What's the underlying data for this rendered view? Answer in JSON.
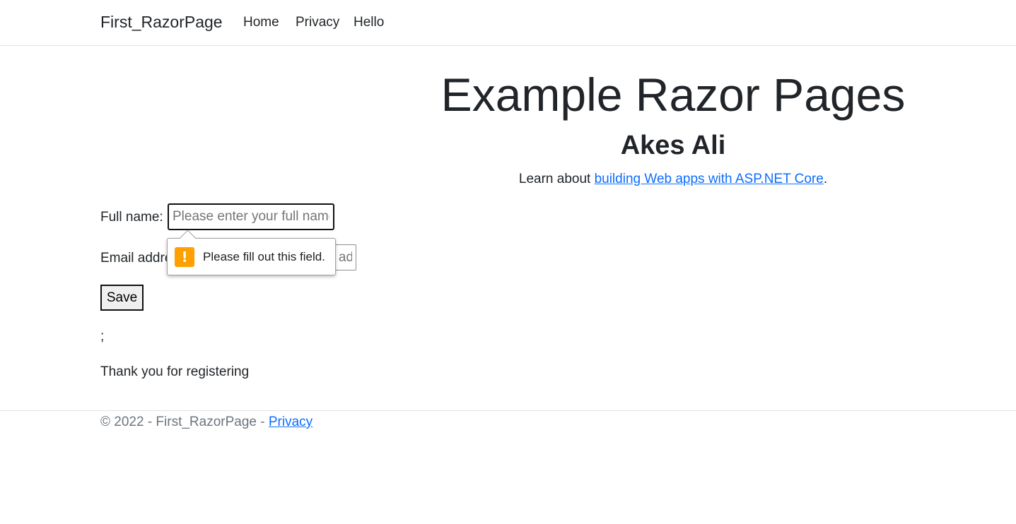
{
  "navbar": {
    "brand": "First_RazorPage",
    "links": [
      "Home",
      "Privacy",
      "Hello"
    ]
  },
  "hero": {
    "title": "Example Razor Pages",
    "name": "Akes Ali",
    "learn_prefix": "Learn about ",
    "learn_link": "building Web apps with ASP.NET Core",
    "learn_suffix": "."
  },
  "form": {
    "fullname_label": "Full name:",
    "fullname_placeholder": "Please enter your full name",
    "fullname_value": "",
    "email_label": "Email address:",
    "email_placeholder": "Please enter your email address",
    "email_value": "",
    "save_label": "Save"
  },
  "validation": {
    "message": "Please fill out this field.",
    "icon": "warning-icon",
    "icon_glyph": "!",
    "icon_color": "#ff9f00"
  },
  "output": {
    "semicolon": ";",
    "thanks": "Thank you for registering"
  },
  "footer": {
    "copyright": "© 2022 - First_RazorPage - ",
    "privacy_link": "Privacy"
  },
  "colors": {
    "link": "#0d6efd",
    "text": "#212529",
    "muted": "#6c757d"
  }
}
